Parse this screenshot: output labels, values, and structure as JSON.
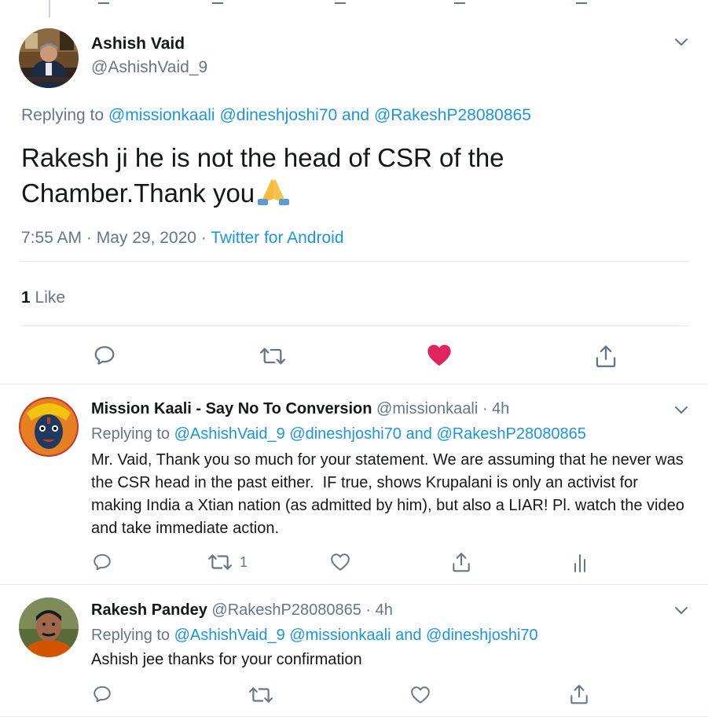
{
  "main_tweet": {
    "author_name": "Ashish Vaid",
    "author_handle": "@AshishVaid_9",
    "replying_prefix": "Replying to",
    "replying_to": [
      "@missionkaali",
      "@dineshjoshi70"
    ],
    "replying_and": "and",
    "replying_last": "@RakeshP28080865",
    "text": "Rakesh ji he is not the head of CSR of the Chamber.Thank you",
    "emoji": "folded-hands",
    "time": "7:55 AM · May 29, 2020 ·",
    "source": "Twitter for Android",
    "likes_count": "1",
    "likes_label": "Like",
    "liked": true,
    "accent_color": "#e0245e"
  },
  "replies": [
    {
      "author_name": "Mission Kaali - Say No To Conversion",
      "author_handle": "@missionkaali · 4h",
      "replying_prefix": "Replying to",
      "replying_to": [
        "@AshishVaid_9",
        "@dineshjoshi70"
      ],
      "replying_and": "and",
      "replying_last": "@RakeshP28080865",
      "text": "Mr. Vaid, Thank you so much for your statement. We are assuming that he never was the CSR head in the past either.  IF true, shows Krupalani is only an activist for making India a Xtian nation (as admitted by him), but also a LIAR! Pl. watch the video and take immediate action.",
      "retweet_count": "1"
    },
    {
      "author_name": "Rakesh Pandey",
      "author_handle": "@RakeshP28080865 · 4h",
      "replying_prefix": "Replying to",
      "replying_to": [
        "@AshishVaid_9",
        "@missionkaali"
      ],
      "replying_and": "and",
      "replying_last": "@dineshjoshi70",
      "text": "Ashish jee thanks for your confirmation"
    }
  ]
}
